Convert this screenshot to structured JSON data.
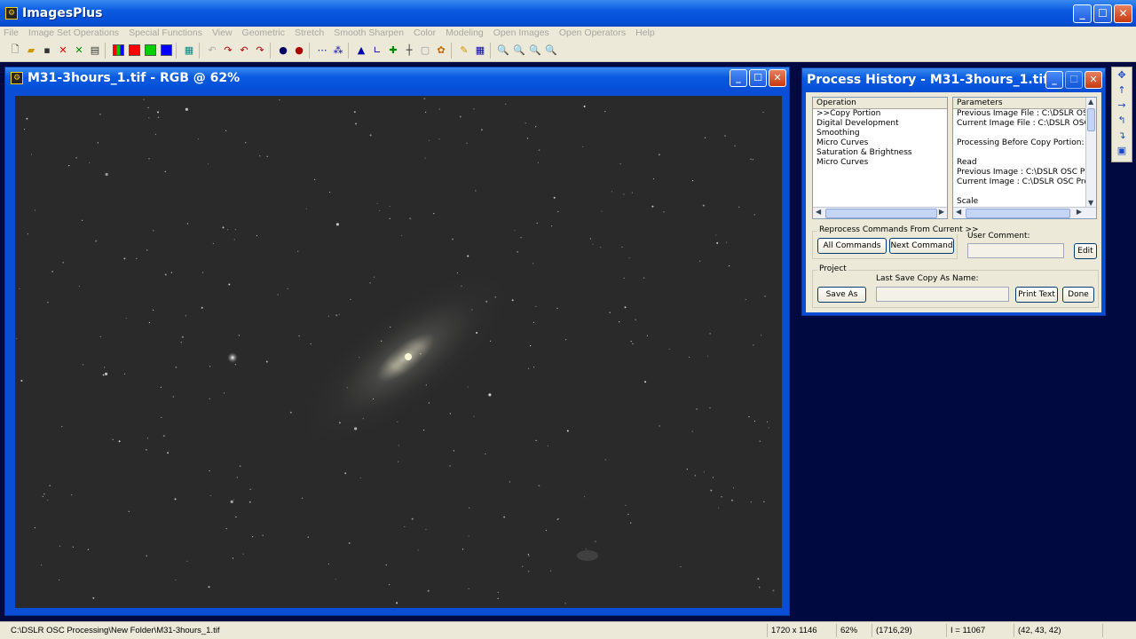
{
  "app": {
    "title": "ImagesPlus",
    "logo_char": "⚙"
  },
  "menu": [
    "File",
    "Image Set Operations",
    "Special Functions",
    "View",
    "Geometric",
    "Stretch",
    "Smooth Sharpen",
    "Color",
    "Modeling",
    "Open Images",
    "Open Operators",
    "Help"
  ],
  "toolbar": {
    "tools": [
      "new-icon",
      "open-icon",
      "save-icon",
      "close-red-icon",
      "close-green-icon",
      "print-icon",
      "|",
      "rgb-icon",
      "red-channel-icon",
      "green-channel-icon",
      "blue-channel-icon",
      "|",
      "grid-teal-icon",
      "|",
      "undo-small-icon",
      "redo-small-icon",
      "undo-icon",
      "redo-icon",
      "|",
      "dot-mask-icon",
      "dot-red-icon",
      "|",
      "dots-icon",
      "split-icon",
      "|",
      "levels-icon",
      "curve-icon",
      "plus-icon",
      "crosshair-icon",
      "frame-icon",
      "palette-icon",
      "|",
      "pencil-icon",
      "grid-icon",
      "|",
      "zoom-in-icon",
      "zoom-out-icon",
      "zoom-fit-icon",
      "zoom-reset-icon"
    ],
    "swatches": {
      "red": "#ff0000",
      "green": "#00d000",
      "blue": "#0000ff"
    }
  },
  "image_window": {
    "title": "M31-3hours_1.tif - RGB @ 62%"
  },
  "process_history": {
    "title": "Process History - M31-3hours_1.tif",
    "operation_header": "Operation",
    "operations": [
      ">>Copy Portion",
      "Digital Development",
      "Smoothing",
      "Micro Curves",
      "Saturation & Brightness",
      "Micro Curves"
    ],
    "parameters_header": "Parameters",
    "parameters": [
      "Previous Image File : C:\\DSLR OSC F",
      "Current Image File : C:\\DSLR OSC Pr",
      "",
      "Processing Before Copy Portion:",
      "",
      "Read",
      "Previous Image : C:\\DSLR OSC Proce",
      "Current Image : C:\\DSLR OSC Proces",
      "",
      "Scale"
    ],
    "reprocess_label": "Reprocess Commands From Current >>",
    "all_commands": "All Commands",
    "next_command": "Next Command",
    "user_comment_label": "User Comment:",
    "user_comment_value": "",
    "edit": "Edit",
    "project_label": "Project",
    "save_as": "Save As",
    "last_save_label": "Last Save Copy As Name:",
    "last_save_value": "",
    "print_text": "Print Text",
    "done": "Done"
  },
  "vertical_toolbar": [
    "move-all-icon",
    "arrow-up-icon",
    "arrow-right-icon",
    "arrow-turn-left-icon",
    "arrow-turn-down-icon",
    "window-icon"
  ],
  "status": {
    "path": "C:\\DSLR OSC Processing\\New Folder\\M31-3hours_1.tif",
    "dimensions": "1720 x 1146",
    "zoom": "62%",
    "coords": "(1716,29)",
    "intensity": "I = 11067",
    "rgb": "(42, 43, 42)"
  }
}
